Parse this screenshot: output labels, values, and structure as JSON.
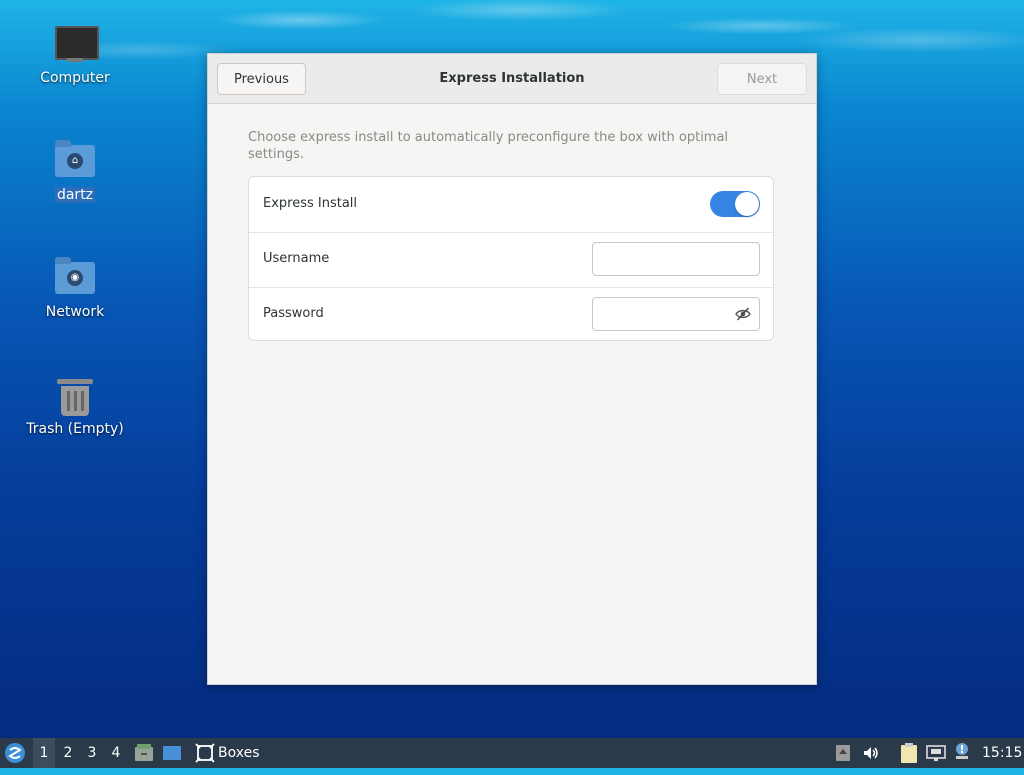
{
  "desktop": {
    "icons": [
      {
        "label": "Computer",
        "icon": "computer-icon"
      },
      {
        "label": "dartz",
        "icon": "home-folder-icon"
      },
      {
        "label": "Network",
        "icon": "network-folder-icon"
      },
      {
        "label": "Trash (Empty)",
        "icon": "trash-icon"
      }
    ]
  },
  "dialog": {
    "title": "Express Installation",
    "previous_label": "Previous",
    "next_label": "Next",
    "description": "Choose express install to automatically preconfigure the box with optimal settings.",
    "rows": {
      "express_install": {
        "label": "Express Install",
        "enabled": true
      },
      "username": {
        "label": "Username",
        "value": ""
      },
      "password": {
        "label": "Password",
        "value": ""
      }
    },
    "accent_color": "#3584e4"
  },
  "taskbar": {
    "workspaces": [
      "1",
      "2",
      "3",
      "4"
    ],
    "active_workspace": "1",
    "window_button_label": "Boxes",
    "clock": "15:15"
  }
}
